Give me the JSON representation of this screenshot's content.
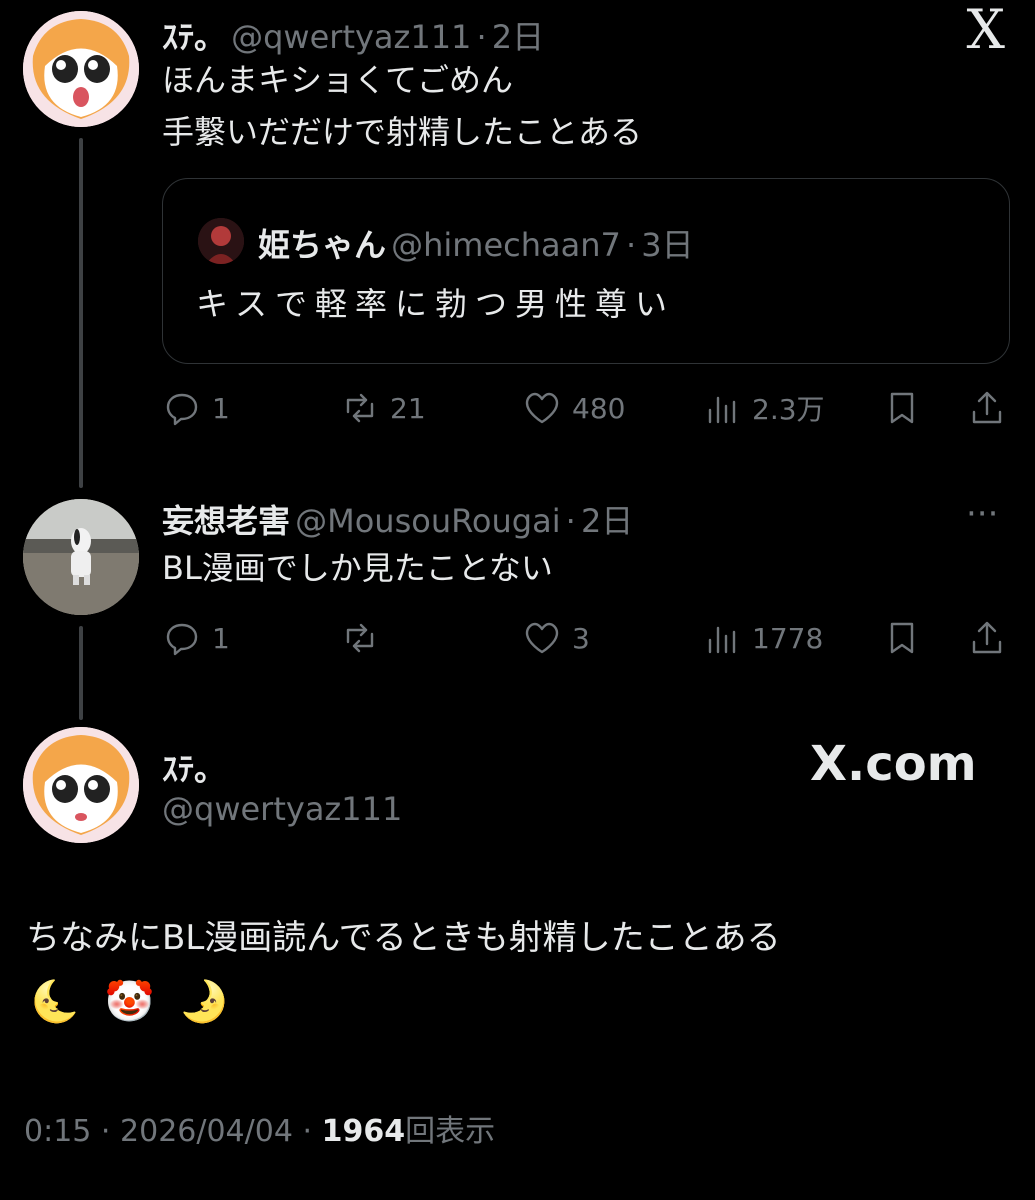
{
  "tweet1": {
    "display_name": "ｽﾃ。",
    "handle": "@qwertyaz111",
    "sep": "·",
    "time": "2日",
    "line1": "ほんまキショくてごめん",
    "line2": "手繋いだだけで射精したことある",
    "quote": {
      "display_name": "姫ちゃん",
      "handle": "@himechaan7",
      "sep": "·",
      "time": "3日",
      "text": "キスで軽率に勃つ男性尊い"
    },
    "actions": {
      "replies": "1",
      "retweets": "21",
      "likes": "480",
      "views": "2.3万"
    }
  },
  "tweet2": {
    "display_name": "妄想老害",
    "handle": "@MousouRougai",
    "sep": "·",
    "time": "2日",
    "text": "BL漫画でしか見たことない",
    "more": "···",
    "actions": {
      "replies": "1",
      "retweets": "",
      "likes": "3",
      "views": "1778"
    }
  },
  "main": {
    "display_name": "ｽﾃ。",
    "handle": "@qwertyaz111",
    "watermark": "X.com",
    "text": "ちなみにBL漫画読んでるときも射精したことある",
    "emoji": "🌜 🤡 🌛",
    "footer": {
      "time": "0:15",
      "sep1": "·",
      "date": "2026/04/04",
      "sep2": "·",
      "views": "1964",
      "views_label": "回表示"
    }
  },
  "header": {
    "logo": "X"
  },
  "colors": {
    "bg": "#000000",
    "text": "#e7e9ea",
    "muted": "#71767b",
    "border": "#2f3336"
  }
}
